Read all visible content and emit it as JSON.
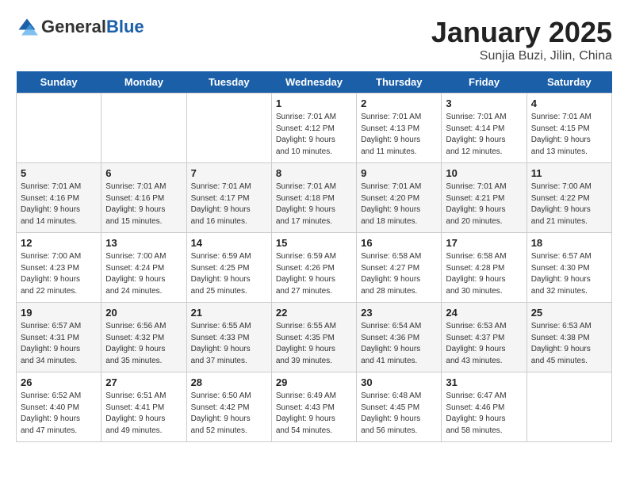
{
  "header": {
    "logo_general": "General",
    "logo_blue": "Blue",
    "month": "January 2025",
    "location": "Sunjia Buzi, Jilin, China"
  },
  "days_of_week": [
    "Sunday",
    "Monday",
    "Tuesday",
    "Wednesday",
    "Thursday",
    "Friday",
    "Saturday"
  ],
  "weeks": [
    [
      {
        "day": "",
        "detail": ""
      },
      {
        "day": "",
        "detail": ""
      },
      {
        "day": "",
        "detail": ""
      },
      {
        "day": "1",
        "detail": "Sunrise: 7:01 AM\nSunset: 4:12 PM\nDaylight: 9 hours\nand 10 minutes."
      },
      {
        "day": "2",
        "detail": "Sunrise: 7:01 AM\nSunset: 4:13 PM\nDaylight: 9 hours\nand 11 minutes."
      },
      {
        "day": "3",
        "detail": "Sunrise: 7:01 AM\nSunset: 4:14 PM\nDaylight: 9 hours\nand 12 minutes."
      },
      {
        "day": "4",
        "detail": "Sunrise: 7:01 AM\nSunset: 4:15 PM\nDaylight: 9 hours\nand 13 minutes."
      }
    ],
    [
      {
        "day": "5",
        "detail": "Sunrise: 7:01 AM\nSunset: 4:16 PM\nDaylight: 9 hours\nand 14 minutes."
      },
      {
        "day": "6",
        "detail": "Sunrise: 7:01 AM\nSunset: 4:16 PM\nDaylight: 9 hours\nand 15 minutes."
      },
      {
        "day": "7",
        "detail": "Sunrise: 7:01 AM\nSunset: 4:17 PM\nDaylight: 9 hours\nand 16 minutes."
      },
      {
        "day": "8",
        "detail": "Sunrise: 7:01 AM\nSunset: 4:18 PM\nDaylight: 9 hours\nand 17 minutes."
      },
      {
        "day": "9",
        "detail": "Sunrise: 7:01 AM\nSunset: 4:20 PM\nDaylight: 9 hours\nand 18 minutes."
      },
      {
        "day": "10",
        "detail": "Sunrise: 7:01 AM\nSunset: 4:21 PM\nDaylight: 9 hours\nand 20 minutes."
      },
      {
        "day": "11",
        "detail": "Sunrise: 7:00 AM\nSunset: 4:22 PM\nDaylight: 9 hours\nand 21 minutes."
      }
    ],
    [
      {
        "day": "12",
        "detail": "Sunrise: 7:00 AM\nSunset: 4:23 PM\nDaylight: 9 hours\nand 22 minutes."
      },
      {
        "day": "13",
        "detail": "Sunrise: 7:00 AM\nSunset: 4:24 PM\nDaylight: 9 hours\nand 24 minutes."
      },
      {
        "day": "14",
        "detail": "Sunrise: 6:59 AM\nSunset: 4:25 PM\nDaylight: 9 hours\nand 25 minutes."
      },
      {
        "day": "15",
        "detail": "Sunrise: 6:59 AM\nSunset: 4:26 PM\nDaylight: 9 hours\nand 27 minutes."
      },
      {
        "day": "16",
        "detail": "Sunrise: 6:58 AM\nSunset: 4:27 PM\nDaylight: 9 hours\nand 28 minutes."
      },
      {
        "day": "17",
        "detail": "Sunrise: 6:58 AM\nSunset: 4:28 PM\nDaylight: 9 hours\nand 30 minutes."
      },
      {
        "day": "18",
        "detail": "Sunrise: 6:57 AM\nSunset: 4:30 PM\nDaylight: 9 hours\nand 32 minutes."
      }
    ],
    [
      {
        "day": "19",
        "detail": "Sunrise: 6:57 AM\nSunset: 4:31 PM\nDaylight: 9 hours\nand 34 minutes."
      },
      {
        "day": "20",
        "detail": "Sunrise: 6:56 AM\nSunset: 4:32 PM\nDaylight: 9 hours\nand 35 minutes."
      },
      {
        "day": "21",
        "detail": "Sunrise: 6:55 AM\nSunset: 4:33 PM\nDaylight: 9 hours\nand 37 minutes."
      },
      {
        "day": "22",
        "detail": "Sunrise: 6:55 AM\nSunset: 4:35 PM\nDaylight: 9 hours\nand 39 minutes."
      },
      {
        "day": "23",
        "detail": "Sunrise: 6:54 AM\nSunset: 4:36 PM\nDaylight: 9 hours\nand 41 minutes."
      },
      {
        "day": "24",
        "detail": "Sunrise: 6:53 AM\nSunset: 4:37 PM\nDaylight: 9 hours\nand 43 minutes."
      },
      {
        "day": "25",
        "detail": "Sunrise: 6:53 AM\nSunset: 4:38 PM\nDaylight: 9 hours\nand 45 minutes."
      }
    ],
    [
      {
        "day": "26",
        "detail": "Sunrise: 6:52 AM\nSunset: 4:40 PM\nDaylight: 9 hours\nand 47 minutes."
      },
      {
        "day": "27",
        "detail": "Sunrise: 6:51 AM\nSunset: 4:41 PM\nDaylight: 9 hours\nand 49 minutes."
      },
      {
        "day": "28",
        "detail": "Sunrise: 6:50 AM\nSunset: 4:42 PM\nDaylight: 9 hours\nand 52 minutes."
      },
      {
        "day": "29",
        "detail": "Sunrise: 6:49 AM\nSunset: 4:43 PM\nDaylight: 9 hours\nand 54 minutes."
      },
      {
        "day": "30",
        "detail": "Sunrise: 6:48 AM\nSunset: 4:45 PM\nDaylight: 9 hours\nand 56 minutes."
      },
      {
        "day": "31",
        "detail": "Sunrise: 6:47 AM\nSunset: 4:46 PM\nDaylight: 9 hours\nand 58 minutes."
      },
      {
        "day": "",
        "detail": ""
      }
    ]
  ]
}
